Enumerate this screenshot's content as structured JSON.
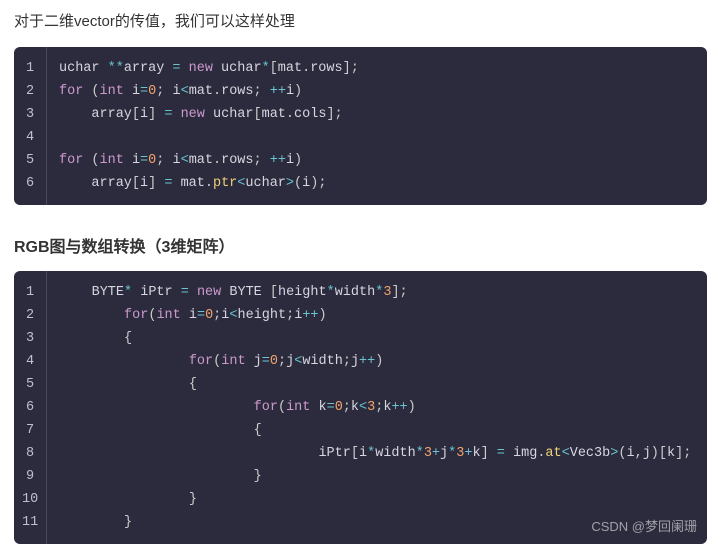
{
  "intro": "对于二维vector的传值，我们可以这样处理",
  "section_title": "RGB图与数组转换（3维矩阵）",
  "watermark": "CSDN @梦回阑珊",
  "code1": {
    "line_count": 6,
    "tokens": [
      [
        [
          "id",
          "uchar "
        ],
        [
          "op",
          "**"
        ],
        [
          "id",
          "array "
        ],
        [
          "op",
          "="
        ],
        [
          "id",
          " "
        ],
        [
          "kw",
          "new"
        ],
        [
          "id",
          " uchar"
        ],
        [
          "op",
          "*"
        ],
        [
          "punc",
          "["
        ],
        [
          "id",
          "mat"
        ],
        [
          "punc",
          "."
        ],
        [
          "id",
          "rows"
        ],
        [
          "punc",
          "]"
        ],
        [
          "punc",
          ";"
        ]
      ],
      [
        [
          "kw",
          "for"
        ],
        [
          "id",
          " "
        ],
        [
          "punc",
          "("
        ],
        [
          "type",
          "int"
        ],
        [
          "id",
          " i"
        ],
        [
          "op",
          "="
        ],
        [
          "num",
          "0"
        ],
        [
          "punc",
          ";"
        ],
        [
          "id",
          " i"
        ],
        [
          "op",
          "<"
        ],
        [
          "id",
          "mat"
        ],
        [
          "punc",
          "."
        ],
        [
          "id",
          "rows"
        ],
        [
          "punc",
          ";"
        ],
        [
          "id",
          " "
        ],
        [
          "op",
          "++"
        ],
        [
          "id",
          "i"
        ],
        [
          "punc",
          ")"
        ]
      ],
      [
        [
          "id",
          "    array"
        ],
        [
          "punc",
          "["
        ],
        [
          "id",
          "i"
        ],
        [
          "punc",
          "]"
        ],
        [
          "id",
          " "
        ],
        [
          "op",
          "="
        ],
        [
          "id",
          " "
        ],
        [
          "kw",
          "new"
        ],
        [
          "id",
          " uchar"
        ],
        [
          "punc",
          "["
        ],
        [
          "id",
          "mat"
        ],
        [
          "punc",
          "."
        ],
        [
          "id",
          "cols"
        ],
        [
          "punc",
          "]"
        ],
        [
          "punc",
          ";"
        ]
      ],
      [],
      [
        [
          "kw",
          "for"
        ],
        [
          "id",
          " "
        ],
        [
          "punc",
          "("
        ],
        [
          "type",
          "int"
        ],
        [
          "id",
          " i"
        ],
        [
          "op",
          "="
        ],
        [
          "num",
          "0"
        ],
        [
          "punc",
          ";"
        ],
        [
          "id",
          " i"
        ],
        [
          "op",
          "<"
        ],
        [
          "id",
          "mat"
        ],
        [
          "punc",
          "."
        ],
        [
          "id",
          "rows"
        ],
        [
          "punc",
          ";"
        ],
        [
          "id",
          " "
        ],
        [
          "op",
          "++"
        ],
        [
          "id",
          "i"
        ],
        [
          "punc",
          ")"
        ]
      ],
      [
        [
          "id",
          "    array"
        ],
        [
          "punc",
          "["
        ],
        [
          "id",
          "i"
        ],
        [
          "punc",
          "]"
        ],
        [
          "id",
          " "
        ],
        [
          "op",
          "="
        ],
        [
          "id",
          " mat"
        ],
        [
          "punc",
          "."
        ],
        [
          "fn",
          "ptr"
        ],
        [
          "op",
          "<"
        ],
        [
          "id",
          "uchar"
        ],
        [
          "op",
          ">"
        ],
        [
          "punc",
          "("
        ],
        [
          "id",
          "i"
        ],
        [
          "punc",
          ")"
        ],
        [
          "punc",
          ";"
        ]
      ]
    ]
  },
  "code2": {
    "line_count": 11,
    "tokens": [
      [
        [
          "id",
          "    BYTE"
        ],
        [
          "op",
          "*"
        ],
        [
          "id",
          " iPtr "
        ],
        [
          "op",
          "="
        ],
        [
          "id",
          " "
        ],
        [
          "kw",
          "new"
        ],
        [
          "id",
          " BYTE "
        ],
        [
          "punc",
          "["
        ],
        [
          "id",
          "height"
        ],
        [
          "op",
          "*"
        ],
        [
          "id",
          "width"
        ],
        [
          "op",
          "*"
        ],
        [
          "num",
          "3"
        ],
        [
          "punc",
          "]"
        ],
        [
          "punc",
          ";"
        ]
      ],
      [
        [
          "id",
          "        "
        ],
        [
          "kw",
          "for"
        ],
        [
          "punc",
          "("
        ],
        [
          "type",
          "int"
        ],
        [
          "id",
          " i"
        ],
        [
          "op",
          "="
        ],
        [
          "num",
          "0"
        ],
        [
          "punc",
          ";"
        ],
        [
          "id",
          "i"
        ],
        [
          "op",
          "<"
        ],
        [
          "id",
          "height"
        ],
        [
          "punc",
          ";"
        ],
        [
          "id",
          "i"
        ],
        [
          "op",
          "++"
        ],
        [
          "punc",
          ")"
        ]
      ],
      [
        [
          "id",
          "        "
        ],
        [
          "punc",
          "{"
        ]
      ],
      [
        [
          "id",
          "                "
        ],
        [
          "kw",
          "for"
        ],
        [
          "punc",
          "("
        ],
        [
          "type",
          "int"
        ],
        [
          "id",
          " j"
        ],
        [
          "op",
          "="
        ],
        [
          "num",
          "0"
        ],
        [
          "punc",
          ";"
        ],
        [
          "id",
          "j"
        ],
        [
          "op",
          "<"
        ],
        [
          "id",
          "width"
        ],
        [
          "punc",
          ";"
        ],
        [
          "id",
          "j"
        ],
        [
          "op",
          "++"
        ],
        [
          "punc",
          ")"
        ]
      ],
      [
        [
          "id",
          "                "
        ],
        [
          "punc",
          "{"
        ]
      ],
      [
        [
          "id",
          "                        "
        ],
        [
          "kw",
          "for"
        ],
        [
          "punc",
          "("
        ],
        [
          "type",
          "int"
        ],
        [
          "id",
          " k"
        ],
        [
          "op",
          "="
        ],
        [
          "num",
          "0"
        ],
        [
          "punc",
          ";"
        ],
        [
          "id",
          "k"
        ],
        [
          "op",
          "<"
        ],
        [
          "num",
          "3"
        ],
        [
          "punc",
          ";"
        ],
        [
          "id",
          "k"
        ],
        [
          "op",
          "++"
        ],
        [
          "punc",
          ")"
        ]
      ],
      [
        [
          "id",
          "                        "
        ],
        [
          "punc",
          "{"
        ]
      ],
      [
        [
          "id",
          "                                iPtr"
        ],
        [
          "punc",
          "["
        ],
        [
          "id",
          "i"
        ],
        [
          "op",
          "*"
        ],
        [
          "id",
          "width"
        ],
        [
          "op",
          "*"
        ],
        [
          "num",
          "3"
        ],
        [
          "op",
          "+"
        ],
        [
          "id",
          "j"
        ],
        [
          "op",
          "*"
        ],
        [
          "num",
          "3"
        ],
        [
          "op",
          "+"
        ],
        [
          "id",
          "k"
        ],
        [
          "punc",
          "]"
        ],
        [
          "id",
          " "
        ],
        [
          "op",
          "="
        ],
        [
          "id",
          " img"
        ],
        [
          "punc",
          "."
        ],
        [
          "fn",
          "at"
        ],
        [
          "op",
          "<"
        ],
        [
          "id",
          "Vec3b"
        ],
        [
          "op",
          ">"
        ],
        [
          "punc",
          "("
        ],
        [
          "id",
          "i"
        ],
        [
          "punc",
          ","
        ],
        [
          "id",
          "j"
        ],
        [
          "punc",
          ")"
        ],
        [
          "punc",
          "["
        ],
        [
          "id",
          "k"
        ],
        [
          "punc",
          "]"
        ],
        [
          "punc",
          ";"
        ]
      ],
      [
        [
          "id",
          "                        "
        ],
        [
          "punc",
          "}"
        ]
      ],
      [
        [
          "id",
          "                "
        ],
        [
          "punc",
          "}"
        ]
      ],
      [
        [
          "id",
          "        "
        ],
        [
          "punc",
          "}"
        ]
      ]
    ]
  }
}
